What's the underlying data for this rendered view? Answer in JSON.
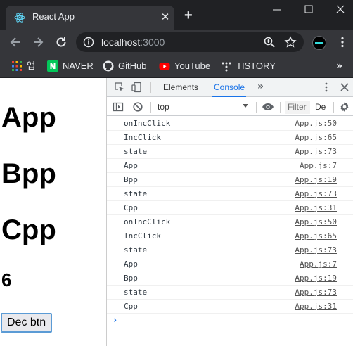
{
  "browser": {
    "tab_title": "React App",
    "tab_close": "✕",
    "new_tab": "+",
    "url_host": "localhost",
    "url_port": ":3000"
  },
  "bookmarks": [
    {
      "label": "앱",
      "icon": "apps-grid-icon"
    },
    {
      "label": "NAVER",
      "icon": "naver-icon"
    },
    {
      "label": "GitHub",
      "icon": "github-icon"
    },
    {
      "label": "YouTube",
      "icon": "youtube-icon"
    },
    {
      "label": "TISTORY",
      "icon": "tistory-icon"
    }
  ],
  "bookmarks_more": "»",
  "page": {
    "heading_a": "App",
    "heading_b": "Bpp",
    "heading_c": "Cpp",
    "count": "6",
    "button_label": "Dec btn"
  },
  "devtools": {
    "tabs": [
      "Elements",
      "Console"
    ],
    "active_tab": "Console",
    "more": "»",
    "context": "top",
    "filter_placeholder": "Filter",
    "levels": "De",
    "prompt": "›"
  },
  "console_logs": [
    {
      "msg": "onIncClick",
      "src": "App.js:50"
    },
    {
      "msg": "IncClick",
      "src": "App.js:65"
    },
    {
      "msg": "state",
      "src": "App.js:73"
    },
    {
      "msg": "App",
      "src": "App.js:7"
    },
    {
      "msg": "Bpp",
      "src": "App.js:19"
    },
    {
      "msg": "state",
      "src": "App.js:73"
    },
    {
      "msg": "Cpp",
      "src": "App.js:31"
    },
    {
      "msg": "onIncClick",
      "src": "App.js:50"
    },
    {
      "msg": "IncClick",
      "src": "App.js:65"
    },
    {
      "msg": "state",
      "src": "App.js:73"
    },
    {
      "msg": "App",
      "src": "App.js:7"
    },
    {
      "msg": "Bpp",
      "src": "App.js:19"
    },
    {
      "msg": "state",
      "src": "App.js:73"
    },
    {
      "msg": "Cpp",
      "src": "App.js:31"
    }
  ],
  "colors": {
    "titlebar": "#202124",
    "toolbar": "#35363a",
    "accent": "#1a73e8"
  }
}
